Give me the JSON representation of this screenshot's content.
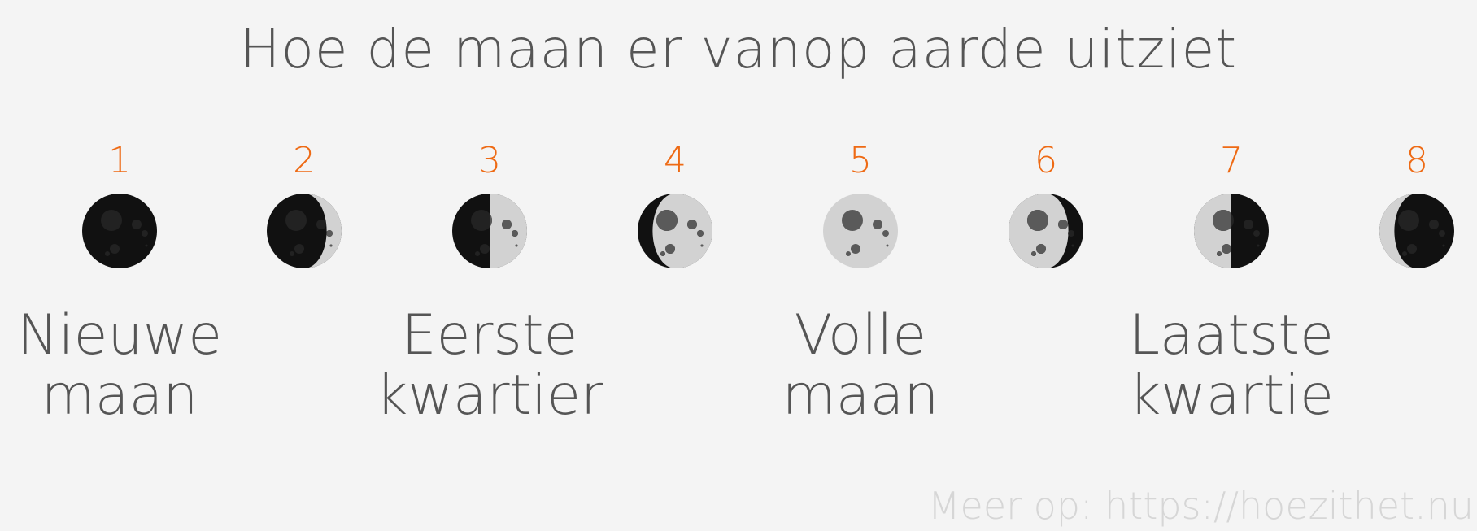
{
  "title": "Hoe de maan er vanop aarde uitziet",
  "phases": [
    {
      "number": "1",
      "illumination": 0.0,
      "waxing": true
    },
    {
      "number": "2",
      "illumination": 0.2,
      "waxing": true
    },
    {
      "number": "3",
      "illumination": 0.5,
      "waxing": true
    },
    {
      "number": "4",
      "illumination": 0.8,
      "waxing": true
    },
    {
      "number": "5",
      "illumination": 1.0,
      "waxing": true
    },
    {
      "number": "6",
      "illumination": 0.8,
      "waxing": false
    },
    {
      "number": "7",
      "illumination": 0.5,
      "waxing": false
    },
    {
      "number": "8",
      "illumination": 0.2,
      "waxing": false
    }
  ],
  "labels": {
    "new_moon": {
      "line1": "Nieuwe",
      "line2": "maan"
    },
    "first_quarter": {
      "line1": "Eerste",
      "line2": "kwartier"
    },
    "full_moon": {
      "line1": "Volle",
      "line2": "maan"
    },
    "last_quarter": {
      "line1": "Laatste",
      "line2": "kwartie"
    }
  },
  "footer": "Meer op: https://hoezithet.nu",
  "colors": {
    "number": "#ee6a14",
    "text": "#555555",
    "footer": "#d6d6d6",
    "moon_lit": "#d2d2d2",
    "moon_dark": "#111111",
    "crater_lit": "#5a5a5a",
    "crater_dark": "#222222"
  }
}
